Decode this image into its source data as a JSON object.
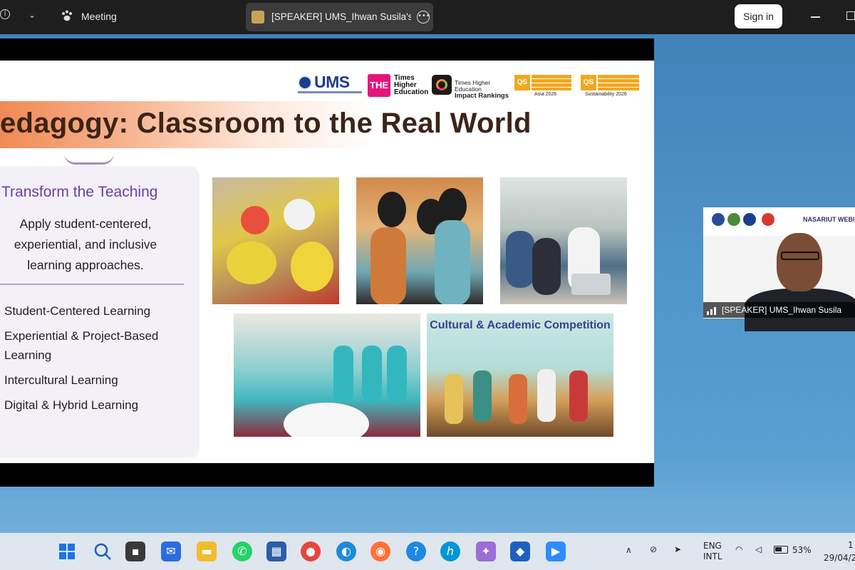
{
  "zoom_bar": {
    "app_label": "Meeting",
    "active_tab": "[SPEAKER] UMS_Ihwan Susila's scr",
    "sign_in": "Sign in"
  },
  "slide": {
    "title": "edagogy: Classroom to the Real World",
    "logos": {
      "ums": "UMS",
      "the_box": "THE",
      "the_text": "Times Higher Education",
      "impact_small": "Times Higher Education",
      "impact_big": "Impact Rankings",
      "qs1_caption": "Asia 2026",
      "qs2_caption": "Sustainability 2026",
      "qs": "QS"
    },
    "panel": {
      "heading": "Transform the Teaching",
      "paragraph": "Apply student-centered, experiential, and inclusive learning approaches.",
      "items": [
        "Student-Centered Learning",
        "Experiential & Project-Based Learning",
        "Intercultural Learning",
        "Digital & Hybrid Learning"
      ]
    },
    "photo5_title": "Cultural & Academic Competition"
  },
  "self_view": {
    "name_label": "[SPEAKER] UMS_Ihwan Susila",
    "banner_text": "NASARIUT WEBINAR"
  },
  "taskbar": {
    "lang_top": "ENG",
    "lang_bottom": "INTL",
    "battery": "53%",
    "time": "1",
    "date": "29/04/2"
  },
  "colors": {
    "zoom_bar": "#1e1e1e",
    "title_band": "#f08a55",
    "panel_heading": "#6a3fa0",
    "desktop": "#4f94c8"
  }
}
